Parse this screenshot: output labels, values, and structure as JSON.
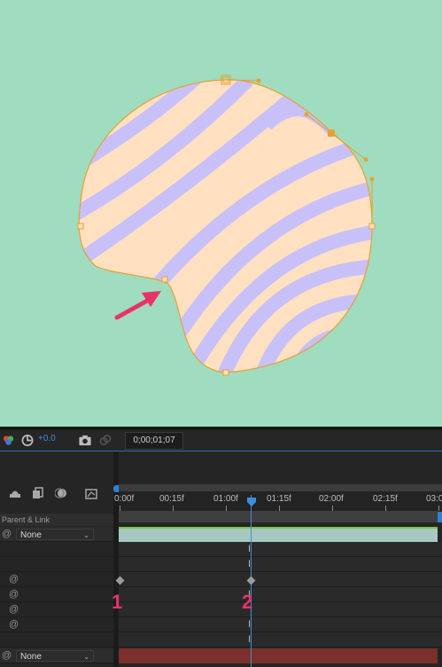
{
  "toolbar": {
    "exposure_value": "+0.0",
    "timecode": "0;00;01;07"
  },
  "timeline": {
    "ruler_labels": [
      "0:00f",
      "00:15f",
      "01:00f",
      "01:15f",
      "02:00f",
      "02:15f",
      "03:0"
    ],
    "current_time_label": "01:00f",
    "parent_link_header": "Parent & Link",
    "parent_value_1": "None",
    "parent_value_2": "None"
  },
  "annotations": {
    "keyframe_label_1": "1",
    "keyframe_label_2": "2"
  },
  "colors": {
    "viewer_background": "#a0dcc0",
    "shape_light": "#ffe0c0",
    "shape_purple": "#c8c0f8",
    "path_orange": "#e8a030",
    "arrow_pink": "#e8336a",
    "playhead_blue": "#3b8fe0",
    "layer_bar": "#a6c8c0",
    "layer_bar_red": "#7a2f2c"
  }
}
